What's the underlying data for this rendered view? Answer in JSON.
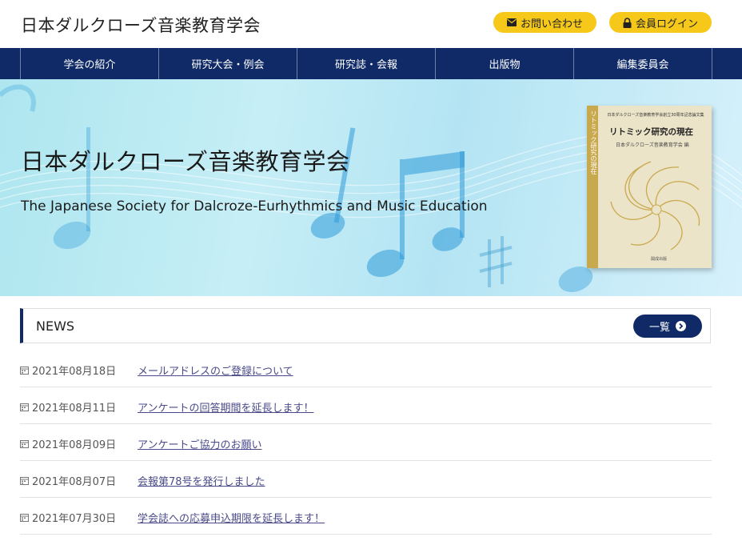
{
  "header": {
    "site_title": "日本ダルクローズ音楽教育学会",
    "contact_label": "お問い合わせ",
    "login_label": "会員ログイン",
    "accent_color": "#f6c81a"
  },
  "nav": {
    "items": [
      {
        "label": "学会の紹介"
      },
      {
        "label": "研究大会・例会"
      },
      {
        "label": "研究誌・会報"
      },
      {
        "label": "出版物"
      },
      {
        "label": "編集委員会"
      }
    ],
    "color": "#0f2a66"
  },
  "hero": {
    "title": "日本ダルクローズ音楽教育学会",
    "subtitle": "The Japanese Society for Dalcroze-Eurhythmics and Music Education",
    "book": {
      "top_text": "日本ダルクローズ音楽教育学会創立30周年記念論文集",
      "title": "リトミック研究の現在",
      "author": "日本ダルクローズ音楽教育学会 編",
      "spine": "リトミック研究の現在",
      "publisher": "開成出版"
    }
  },
  "news": {
    "heading": "NEWS",
    "list_button": "一覧",
    "items": [
      {
        "date": "2021年08月18日",
        "title": "メールアドレスのご登録について"
      },
      {
        "date": "2021年08月11日",
        "title": "アンケートの回答期間を延長します！"
      },
      {
        "date": "2021年08月09日",
        "title": "アンケートご協力のお願い"
      },
      {
        "date": "2021年08月07日",
        "title": "会報第78号を発行しました"
      },
      {
        "date": "2021年07月30日",
        "title": "学会誌への応募申込期限を延長します！"
      }
    ]
  },
  "icons": {
    "contact": "envelope-icon",
    "login": "lock-icon",
    "list": "chevron-circle-right-icon",
    "date": "calendar-icon"
  }
}
